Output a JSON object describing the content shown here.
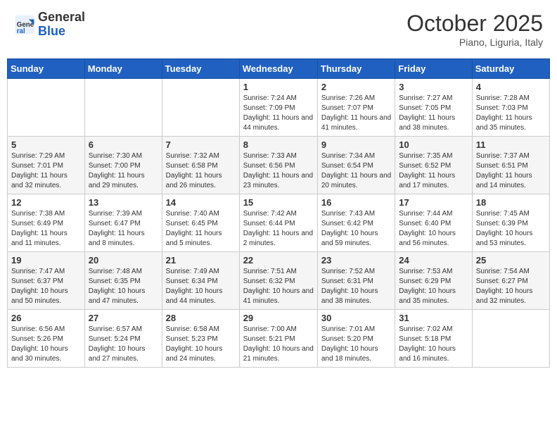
{
  "header": {
    "logo_general": "General",
    "logo_blue": "Blue",
    "month_title": "October 2025",
    "location": "Piano, Liguria, Italy"
  },
  "weekdays": [
    "Sunday",
    "Monday",
    "Tuesday",
    "Wednesday",
    "Thursday",
    "Friday",
    "Saturday"
  ],
  "weeks": [
    [
      {
        "day": "",
        "info": ""
      },
      {
        "day": "",
        "info": ""
      },
      {
        "day": "",
        "info": ""
      },
      {
        "day": "1",
        "info": "Sunrise: 7:24 AM\nSunset: 7:09 PM\nDaylight: 11 hours and 44 minutes."
      },
      {
        "day": "2",
        "info": "Sunrise: 7:26 AM\nSunset: 7:07 PM\nDaylight: 11 hours and 41 minutes."
      },
      {
        "day": "3",
        "info": "Sunrise: 7:27 AM\nSunset: 7:05 PM\nDaylight: 11 hours and 38 minutes."
      },
      {
        "day": "4",
        "info": "Sunrise: 7:28 AM\nSunset: 7:03 PM\nDaylight: 11 hours and 35 minutes."
      }
    ],
    [
      {
        "day": "5",
        "info": "Sunrise: 7:29 AM\nSunset: 7:01 PM\nDaylight: 11 hours and 32 minutes."
      },
      {
        "day": "6",
        "info": "Sunrise: 7:30 AM\nSunset: 7:00 PM\nDaylight: 11 hours and 29 minutes."
      },
      {
        "day": "7",
        "info": "Sunrise: 7:32 AM\nSunset: 6:58 PM\nDaylight: 11 hours and 26 minutes."
      },
      {
        "day": "8",
        "info": "Sunrise: 7:33 AM\nSunset: 6:56 PM\nDaylight: 11 hours and 23 minutes."
      },
      {
        "day": "9",
        "info": "Sunrise: 7:34 AM\nSunset: 6:54 PM\nDaylight: 11 hours and 20 minutes."
      },
      {
        "day": "10",
        "info": "Sunrise: 7:35 AM\nSunset: 6:52 PM\nDaylight: 11 hours and 17 minutes."
      },
      {
        "day": "11",
        "info": "Sunrise: 7:37 AM\nSunset: 6:51 PM\nDaylight: 11 hours and 14 minutes."
      }
    ],
    [
      {
        "day": "12",
        "info": "Sunrise: 7:38 AM\nSunset: 6:49 PM\nDaylight: 11 hours and 11 minutes."
      },
      {
        "day": "13",
        "info": "Sunrise: 7:39 AM\nSunset: 6:47 PM\nDaylight: 11 hours and 8 minutes."
      },
      {
        "day": "14",
        "info": "Sunrise: 7:40 AM\nSunset: 6:45 PM\nDaylight: 11 hours and 5 minutes."
      },
      {
        "day": "15",
        "info": "Sunrise: 7:42 AM\nSunset: 6:44 PM\nDaylight: 11 hours and 2 minutes."
      },
      {
        "day": "16",
        "info": "Sunrise: 7:43 AM\nSunset: 6:42 PM\nDaylight: 10 hours and 59 minutes."
      },
      {
        "day": "17",
        "info": "Sunrise: 7:44 AM\nSunset: 6:40 PM\nDaylight: 10 hours and 56 minutes."
      },
      {
        "day": "18",
        "info": "Sunrise: 7:45 AM\nSunset: 6:39 PM\nDaylight: 10 hours and 53 minutes."
      }
    ],
    [
      {
        "day": "19",
        "info": "Sunrise: 7:47 AM\nSunset: 6:37 PM\nDaylight: 10 hours and 50 minutes."
      },
      {
        "day": "20",
        "info": "Sunrise: 7:48 AM\nSunset: 6:35 PM\nDaylight: 10 hours and 47 minutes."
      },
      {
        "day": "21",
        "info": "Sunrise: 7:49 AM\nSunset: 6:34 PM\nDaylight: 10 hours and 44 minutes."
      },
      {
        "day": "22",
        "info": "Sunrise: 7:51 AM\nSunset: 6:32 PM\nDaylight: 10 hours and 41 minutes."
      },
      {
        "day": "23",
        "info": "Sunrise: 7:52 AM\nSunset: 6:31 PM\nDaylight: 10 hours and 38 minutes."
      },
      {
        "day": "24",
        "info": "Sunrise: 7:53 AM\nSunset: 6:29 PM\nDaylight: 10 hours and 35 minutes."
      },
      {
        "day": "25",
        "info": "Sunrise: 7:54 AM\nSunset: 6:27 PM\nDaylight: 10 hours and 32 minutes."
      }
    ],
    [
      {
        "day": "26",
        "info": "Sunrise: 6:56 AM\nSunset: 5:26 PM\nDaylight: 10 hours and 30 minutes."
      },
      {
        "day": "27",
        "info": "Sunrise: 6:57 AM\nSunset: 5:24 PM\nDaylight: 10 hours and 27 minutes."
      },
      {
        "day": "28",
        "info": "Sunrise: 6:58 AM\nSunset: 5:23 PM\nDaylight: 10 hours and 24 minutes."
      },
      {
        "day": "29",
        "info": "Sunrise: 7:00 AM\nSunset: 5:21 PM\nDaylight: 10 hours and 21 minutes."
      },
      {
        "day": "30",
        "info": "Sunrise: 7:01 AM\nSunset: 5:20 PM\nDaylight: 10 hours and 18 minutes."
      },
      {
        "day": "31",
        "info": "Sunrise: 7:02 AM\nSunset: 5:18 PM\nDaylight: 10 hours and 16 minutes."
      },
      {
        "day": "",
        "info": ""
      }
    ]
  ]
}
